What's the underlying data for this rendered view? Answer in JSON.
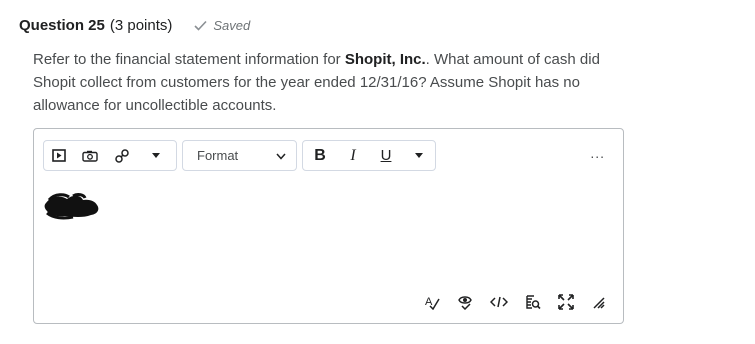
{
  "question": {
    "title": "Question 25",
    "points": "(3 points)",
    "status": "Saved",
    "prompt_before": "Refer to the financial statement information for ",
    "prompt_bold": "Shopit, Inc.",
    "prompt_after": ". What amount of cash did Shopit collect from customers for the year ended 12/31/16? Assume Shopit has no allowance for uncollectible accounts."
  },
  "toolbar": {
    "icons": [
      "insert-stuff-icon",
      "insert-image-icon",
      "insert-link-icon",
      "more-insert-chevron-icon"
    ],
    "format_label": "Format",
    "bold_label": "B",
    "italic_label": "I",
    "underline_label": "U",
    "more_label": "..."
  },
  "bottom_toolbar": {
    "icons": [
      "spellcheck-icon",
      "accessibility-checker-icon",
      "source-code-icon",
      "preview-icon",
      "fullscreen-icon",
      "resize-handle-icon"
    ]
  },
  "colors": {
    "text": "#494c4e",
    "heading": "#202122",
    "border": "#b8bcc0",
    "saved_check": "#6e7376"
  }
}
